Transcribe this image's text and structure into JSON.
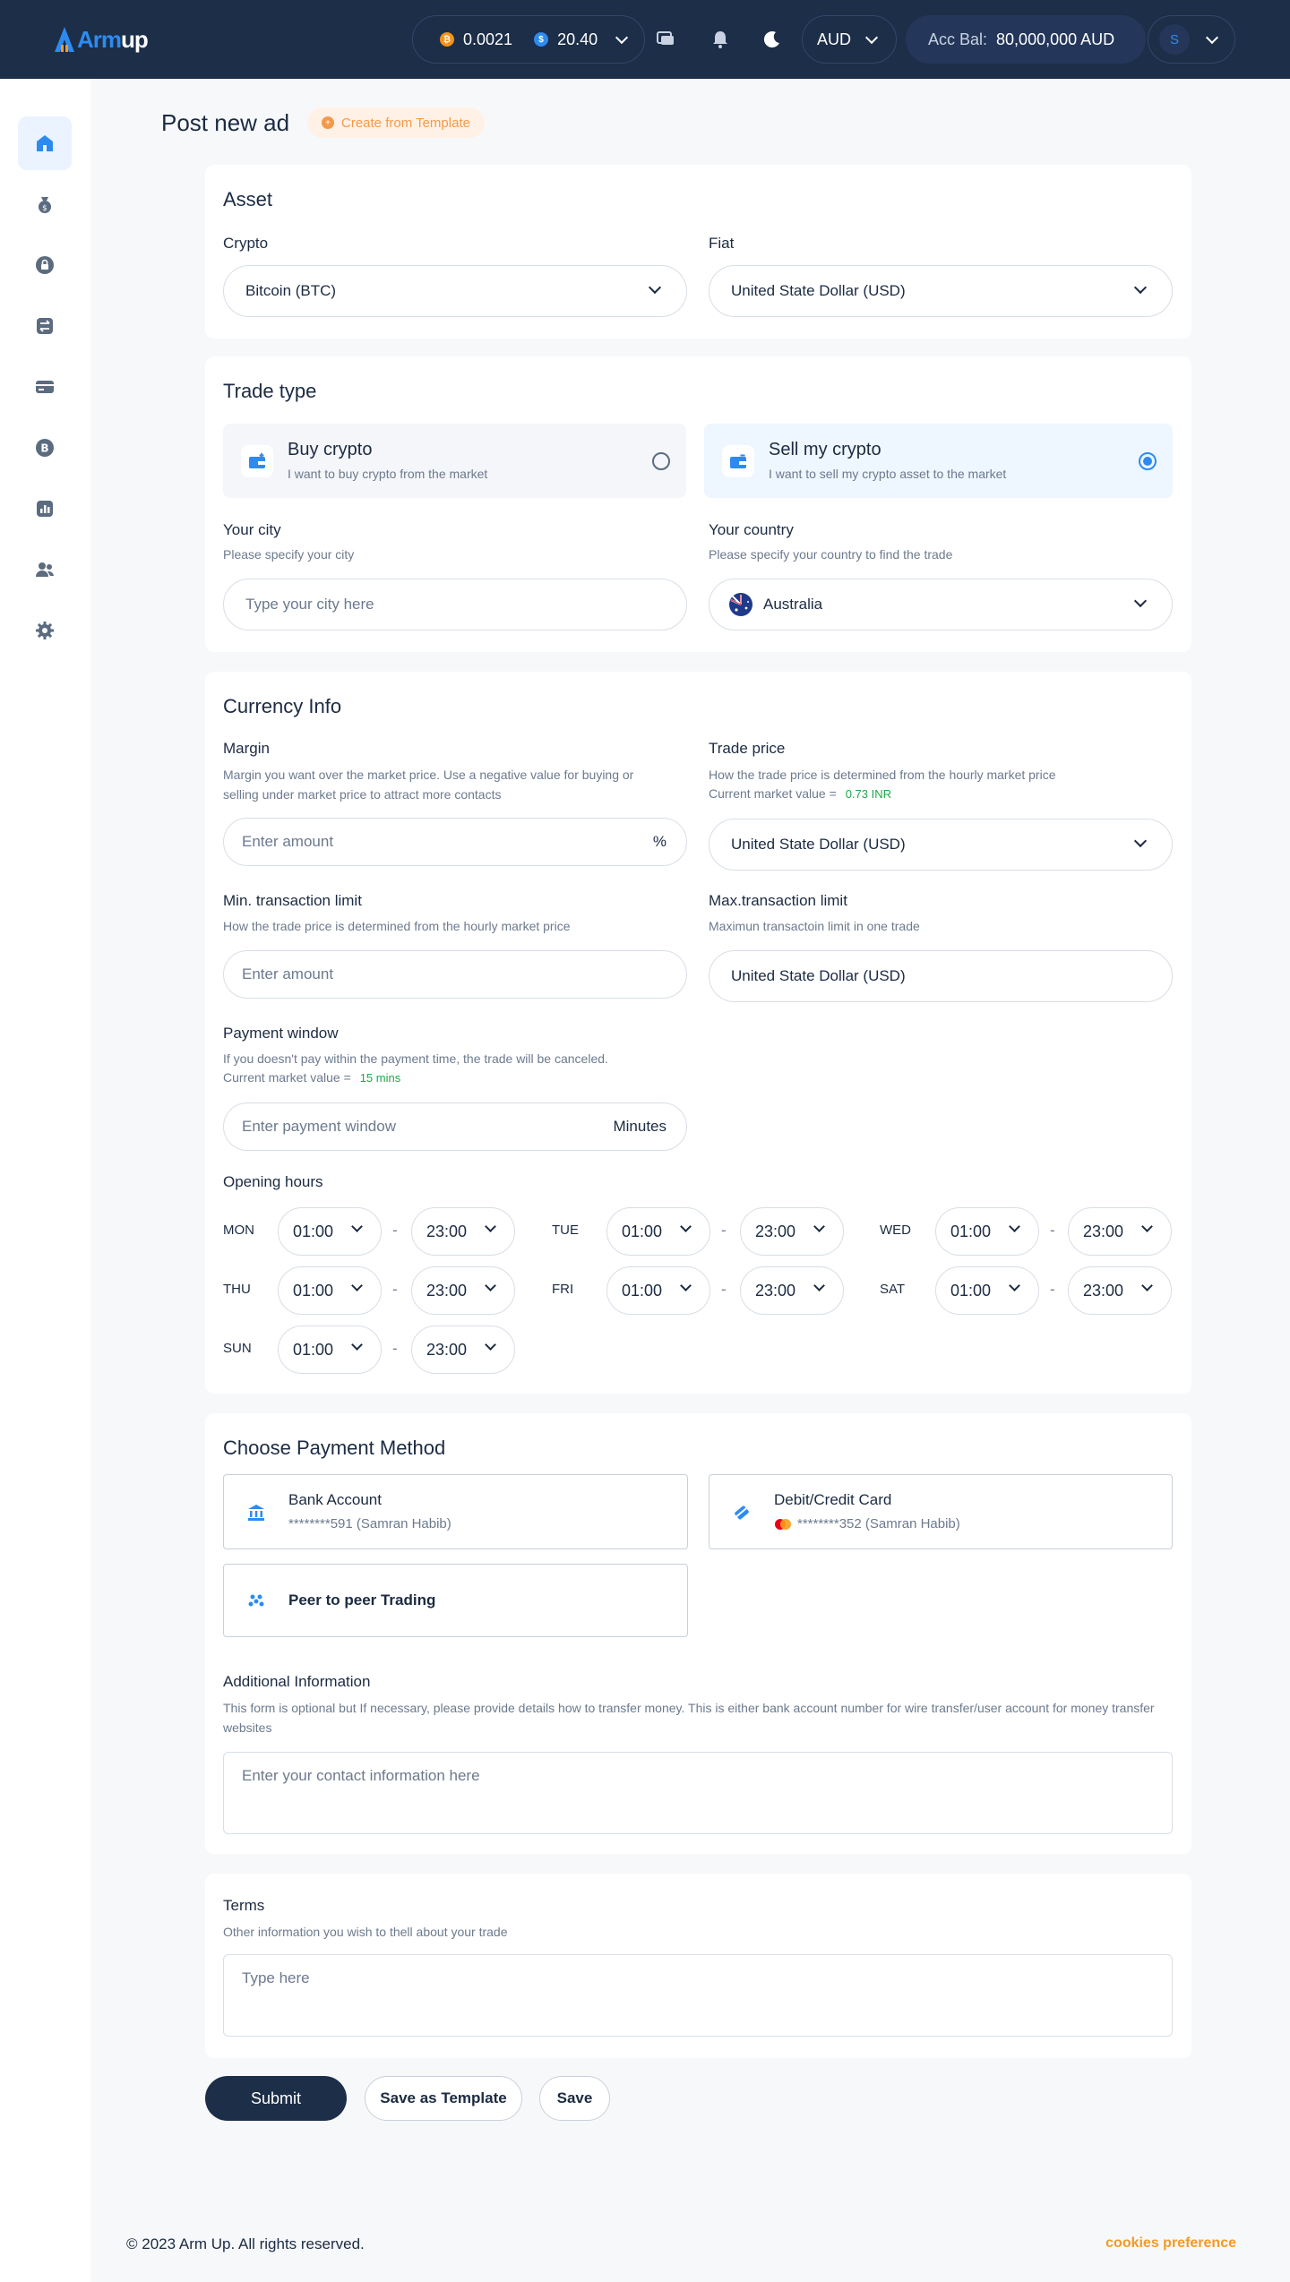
{
  "header": {
    "logo_arm": "Arm",
    "logo_up": "up",
    "btc_balance": "0.0021",
    "usd_balance": "20.40",
    "currency": "AUD",
    "acc_bal_label": "Acc Bal:",
    "acc_bal_value": "80,000,000 AUD",
    "avatar_initial": "S"
  },
  "page": {
    "title": "Post new ad",
    "template_button": "Create from Template"
  },
  "asset": {
    "title": "Asset",
    "crypto_label": "Crypto",
    "crypto_value": "Bitcoin (BTC)",
    "fiat_label": "Fiat",
    "fiat_value": "United State Dollar (USD)"
  },
  "trade_type": {
    "title": "Trade type",
    "buy_title": "Buy crypto",
    "buy_sub": "I want to buy crypto from the market",
    "sell_title": "Sell my crypto",
    "sell_sub": "I want to sell my crypto asset to the market",
    "selected": "sell",
    "city_label": "Your city",
    "city_hint": "Please specify your city",
    "city_placeholder": "Type your city here",
    "country_label": "Your country",
    "country_hint": "Please specify your country to find the trade",
    "country_value": "Australia"
  },
  "currency_info": {
    "title": "Currency Info",
    "margin_label": "Margin",
    "margin_hint": "Margin you want over the market price. Use a negative value for buying or selling under market price to attract more contacts",
    "margin_placeholder": "Enter amount",
    "margin_suffix": "%",
    "trade_price_label": "Trade price",
    "trade_price_hint": "How the trade price is determined from the hourly market price",
    "current_market_label": "Current market value =",
    "current_market_value": "0.73 INR",
    "trade_price_value": "United State Dollar (USD)",
    "min_label": "Min. transaction limit",
    "min_hint": "How the trade price is determined from the hourly market price",
    "min_placeholder": "Enter amount",
    "max_label": "Max.transaction limit",
    "max_hint": "Maximun transactoin limit in one trade",
    "max_value": "United State Dollar (USD)",
    "payment_window_label": "Payment window",
    "payment_window_hint": "If you doesn't pay within the payment time, the trade will be canceled.",
    "payment_window_market_label": "Current market value =",
    "payment_window_market_value": "15 mins",
    "payment_window_placeholder": "Enter payment window",
    "payment_window_suffix": "Minutes",
    "opening_hours_label": "Opening hours",
    "days": [
      {
        "day": "MON",
        "from": "01:00",
        "to": "23:00"
      },
      {
        "day": "TUE",
        "from": "01:00",
        "to": "23:00"
      },
      {
        "day": "WED",
        "from": "01:00",
        "to": "23:00"
      },
      {
        "day": "THU",
        "from": "01:00",
        "to": "23:00"
      },
      {
        "day": "FRI",
        "from": "01:00",
        "to": "23:00"
      },
      {
        "day": "SAT",
        "from": "01:00",
        "to": "23:00"
      },
      {
        "day": "SUN",
        "from": "01:00",
        "to": "23:00"
      }
    ],
    "dash": "-"
  },
  "payment": {
    "title": "Choose Payment Method",
    "bank_title": "Bank Account",
    "bank_sub": "********591 (Samran Habib)",
    "card_title": "Debit/Credit Card",
    "card_sub": "********352 (Samran Habib)",
    "p2p_title": "Peer to peer Trading",
    "additional_label": "Additional Information",
    "additional_hint": "This form is optional but If necessary, please provide details how to transfer money. This is either bank account number for wire transfer/user account for money transfer websites",
    "additional_placeholder": "Enter your contact information here"
  },
  "terms": {
    "label": "Terms",
    "hint": "Other information you wish to thell about your trade",
    "placeholder": "Type here"
  },
  "actions": {
    "submit": "Submit",
    "save_template": "Save as Template",
    "save": "Save"
  },
  "footer": {
    "copyright": "© 2023 Arm Up. All rights reserved.",
    "cookies": "cookies preference"
  },
  "colors": {
    "navy": "#1c2e48",
    "accent": "#2d8bf0",
    "orange": "#f39a4a",
    "green": "#1fa64a"
  }
}
